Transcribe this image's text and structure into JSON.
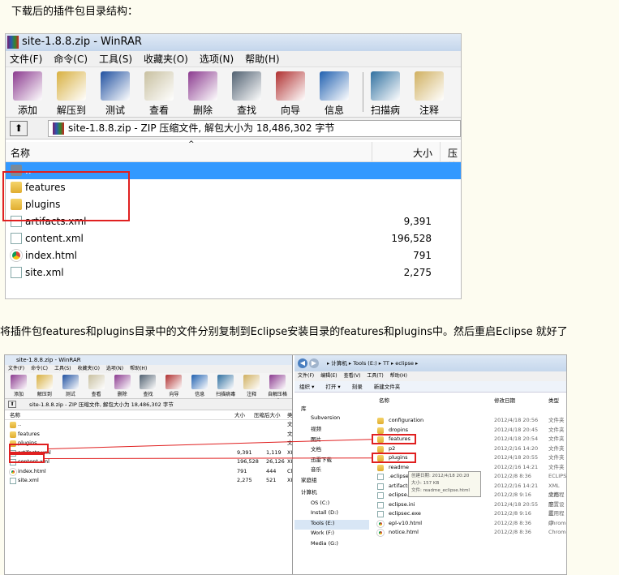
{
  "intro_text": "下载后的插件包目录结构：",
  "instruction_text": "将插件包features和plugins目录中的文件分别复制到Eclipse安装目录的features和plugins中。然后重启Eclipse 就好了",
  "winrar": {
    "title": "site-1.8.8.zip - WinRAR",
    "menu": [
      "文件(F)",
      "命令(C)",
      "工具(S)",
      "收藏夹(O)",
      "选项(N)",
      "帮助(H)"
    ],
    "toolbar": [
      {
        "label": "添加",
        "icon": "add-books-icon",
        "color": "#8b3a8f"
      },
      {
        "label": "解压到",
        "icon": "extract-to-icon",
        "color": "#d8b040"
      },
      {
        "label": "测试",
        "icon": "test-icon",
        "color": "#2050a0"
      },
      {
        "label": "查看",
        "icon": "view-glasses-icon",
        "color": "#c8c0a0"
      },
      {
        "label": "删除",
        "icon": "delete-icon",
        "color": "#8b3a8f"
      },
      {
        "label": "查找",
        "icon": "find-binoculars-icon",
        "color": "#506070"
      },
      {
        "label": "向导",
        "icon": "wizard-icon",
        "color": "#b03030"
      },
      {
        "label": "信息",
        "icon": "info-icon",
        "color": "#2060b0"
      },
      {
        "label": "扫描病毒",
        "icon": "scan-virus-icon",
        "color": "#3070a0"
      },
      {
        "label": "注释",
        "icon": "comment-icon",
        "color": "#d0b060"
      }
    ],
    "address": "site-1.8.8.zip - ZIP 压缩文件, 解包大小为 18,486,302 字节",
    "columns": {
      "name": "名称",
      "size": "大小",
      "packed": "压缩"
    },
    "files": [
      {
        "name": "..",
        "size": "",
        "type": "up",
        "selected": true
      },
      {
        "name": "features",
        "size": "",
        "type": "folder"
      },
      {
        "name": "plugins",
        "size": "",
        "type": "folder"
      },
      {
        "name": "artifacts.xml",
        "size": "9,391",
        "type": "xml"
      },
      {
        "name": "content.xml",
        "size": "196,528",
        "type": "xml"
      },
      {
        "name": "index.html",
        "size": "791",
        "type": "html"
      },
      {
        "name": "site.xml",
        "size": "2,275",
        "type": "xml"
      }
    ]
  },
  "mini_winrar": {
    "title": "site-1.8.8.zip - WinRAR",
    "menu": [
      "文件(F)",
      "命令(C)",
      "工具(S)",
      "收藏夹(O)",
      "选项(N)",
      "帮助(H)"
    ],
    "toolbar": [
      "添加",
      "解压到",
      "测试",
      "查看",
      "删除",
      "查找",
      "向导",
      "信息",
      "扫描病毒",
      "注释",
      "自解压格式"
    ],
    "address": "site-1.8.8.zip - ZIP 压缩文件, 解包大小为 18,486,302 字节",
    "columns": [
      "名称",
      "大小",
      "压缩后大小",
      "类"
    ],
    "files": [
      {
        "name": "..",
        "size": "",
        "packed": "",
        "t": "文"
      },
      {
        "name": "features",
        "size": "",
        "packed": "",
        "t": "文"
      },
      {
        "name": "plugins",
        "size": "",
        "packed": "",
        "t": "文"
      },
      {
        "name": "artifacts.xml",
        "size": "9,391",
        "packed": "1,119",
        "t": "XI"
      },
      {
        "name": "content.xml",
        "size": "196,528",
        "packed": "26,126",
        "t": "XI"
      },
      {
        "name": "index.html",
        "size": "791",
        "packed": "444",
        "t": "Cl"
      },
      {
        "name": "site.xml",
        "size": "2,275",
        "packed": "521",
        "t": "XI"
      }
    ]
  },
  "explorer": {
    "breadcrumb": "▸ 计算机 ▸ Tools (E:) ▸ TT ▸ eclipse ▸",
    "menu": [
      "文件(F)",
      "编辑(E)",
      "查看(V)",
      "工具(T)",
      "帮助(H)"
    ],
    "toolbar": [
      "组织 ▾",
      "打开 ▾",
      "刻录",
      "新建文件夹"
    ],
    "nav": [
      "库",
      "Subversion",
      "视频",
      "图片",
      "文档",
      "迅雷下载",
      "音乐",
      "家庭组",
      "计算机",
      "OS (C:)",
      "Install (D:)",
      "Tools (E:)",
      "Work (F:)",
      "Media (G:)"
    ],
    "columns": [
      "名称",
      "修改日期",
      "类型"
    ],
    "files": [
      {
        "name": "configuration",
        "date": "2012/4/18 20:56",
        "type": "文件夹"
      },
      {
        "name": "dropins",
        "date": "2012/4/18 20:45",
        "type": "文件夹"
      },
      {
        "name": "features",
        "date": "2012/4/18 20:54",
        "type": "文件夹"
      },
      {
        "name": "p2",
        "date": "2012/2/16 14:20",
        "type": "文件夹"
      },
      {
        "name": "plugins",
        "date": "2012/4/18 20:55",
        "type": "文件夹"
      },
      {
        "name": "readme",
        "date": "2012/2/16 14:21",
        "type": "文件夹"
      },
      {
        "name": ".eclipseproduct",
        "date": "2012/2/8 8:36",
        "type": "ECLIPSEP"
      },
      {
        "name": "artifacts.xml",
        "date": "2012/2/16 14:21",
        "type": "XML 文档"
      },
      {
        "name": "eclipse.exe",
        "date": "2012/2/8 9:16",
        "type": "应用程序"
      },
      {
        "name": "eclipse.ini",
        "date": "2012/4/18 20:55",
        "type": "配置设置"
      },
      {
        "name": "eclipsec.exe",
        "date": "2012/2/8 9:16",
        "type": "应用程序"
      },
      {
        "name": "epl-v10.html",
        "date": "2012/2/8 8:36",
        "type": "Chrome"
      },
      {
        "name": "notice.html",
        "date": "2012/2/8 8:36",
        "type": "Chrome"
      }
    ],
    "tooltip": [
      "创建日期: 2012/4/18 20:20",
      "大小: 157 KB",
      "文件: readme_eclipse.html"
    ]
  }
}
